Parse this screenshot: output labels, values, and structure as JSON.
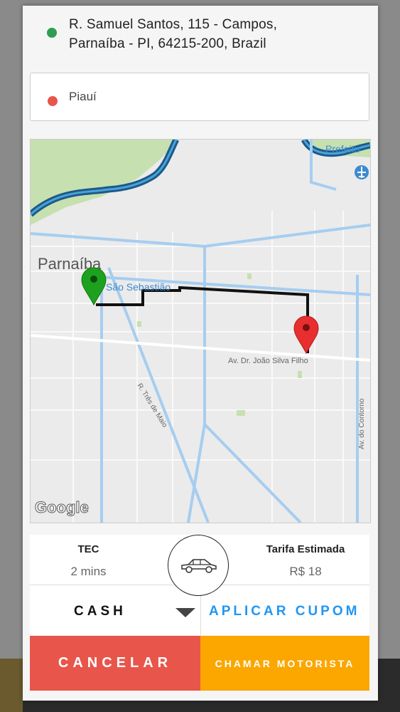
{
  "trip": {
    "origin": {
      "line1": "R. Samuel Santos, 115 - Campos,",
      "line2": "Parnaíba - PI, 64215-200, Brazil",
      "dot_color": "#2e9e52"
    },
    "destination": {
      "text": "Piauí",
      "dot_color": "#e8554a"
    }
  },
  "map": {
    "city_label": "Parnaíba",
    "street_sebastiao": "São Sebastião",
    "street_joao_silva": "Av. Dr. João Silva Filho",
    "street_tres_maio": "R. Três de Maio",
    "street_contorno": "Av. do Contorno",
    "poi_prefeitura": "Prefeitu",
    "attribution": "Google",
    "origin_pin_icon": "green-map-pin-icon",
    "destination_pin_icon": "red-map-pin-icon",
    "airport_icon": "airplane-icon"
  },
  "fare": {
    "tec_label": "TEC",
    "tec_value": "2 mins",
    "fare_label": "Tarifa Estimada",
    "fare_value": "R$ 18",
    "car_icon": "car-icon"
  },
  "payment": {
    "method": "CASH",
    "coupon_label": "APLICAR CUPOM",
    "coupon_color": "#2196f3"
  },
  "actions": {
    "cancel_label": "CANCELAR",
    "call_label": "CHAMAR MOTORISTA",
    "cancel_color": "#e8554a",
    "call_color": "#fca600"
  }
}
